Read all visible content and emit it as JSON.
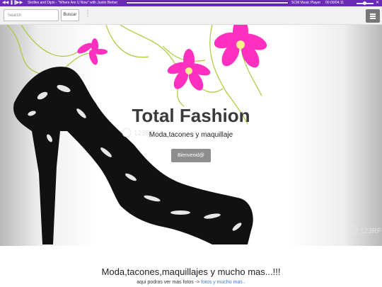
{
  "player": {
    "track": "Skrillex and Diplo - \"Where Are U Now\" with Justin Bieber",
    "brand": "SCM Music Player",
    "time": "00:00/04:11",
    "progress_fraction": 0.0,
    "volume_fraction": 0.5
  },
  "nav": {
    "search_placeholder": "Search",
    "search_button": "Buscar"
  },
  "hero": {
    "title": "Total Fashion",
    "subtitle": "Moda,tacones y maquillaje",
    "button": "Bienvenid@",
    "watermark": "123RF"
  },
  "content": {
    "title": "Moda,tacones,maquillajes y mucho mas...!!!",
    "line_prefix": "aqui podras ver mas fotos ->",
    "link_text": "fotos y mucho mas",
    "line_suffix": "."
  },
  "colors": {
    "player_bar": "#6a2bb5",
    "flower": "#ff2fbf",
    "vine": "#a8c93a",
    "link": "#3a7bd5"
  }
}
